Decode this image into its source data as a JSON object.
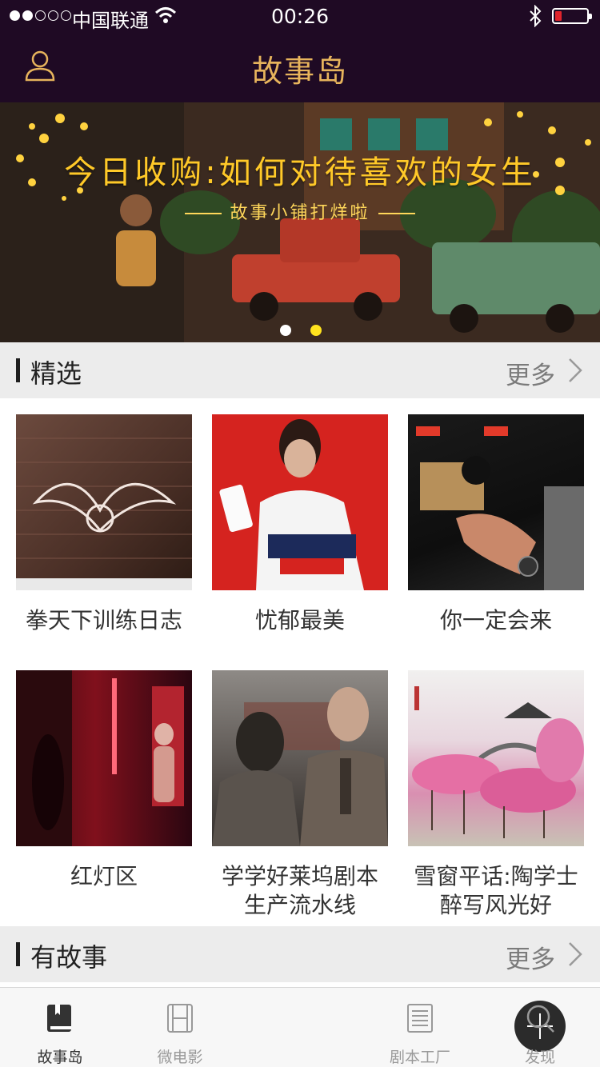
{
  "status": {
    "carrier": "中国联通",
    "time": "00:26"
  },
  "nav": {
    "title": "故事岛"
  },
  "banner": {
    "title": "今日收购:如何对待喜欢的女生",
    "subtitle": "故事小铺打烊啦",
    "page_count": 2,
    "active_page": 2
  },
  "sections": {
    "featured": {
      "title": "精选",
      "more": "更多"
    },
    "stories": {
      "title": "有故事",
      "more": "更多"
    }
  },
  "items": [
    {
      "caption": "拳天下训练日志"
    },
    {
      "caption": "忧郁最美"
    },
    {
      "caption": "你一定会来"
    },
    {
      "caption": "红灯区"
    },
    {
      "caption": "学学好莱坞剧本生产流水线"
    },
    {
      "caption": "雪窗平话:陶学士醉写风光好"
    }
  ],
  "tabs": [
    {
      "label": "故事岛",
      "icon": "book-icon",
      "active": true
    },
    {
      "label": "微电影",
      "icon": "film-icon",
      "active": false
    },
    {
      "label": "",
      "icon": "plus-icon",
      "active": false
    },
    {
      "label": "剧本工厂",
      "icon": "script-icon",
      "active": false
    },
    {
      "label": "发现",
      "icon": "search-icon",
      "active": false
    }
  ],
  "colors": {
    "nav_bg": "#1f0a24",
    "nav_title": "#e7b45c",
    "banner_title": "#ffc928",
    "page_dot_active": "#ffe31e"
  }
}
